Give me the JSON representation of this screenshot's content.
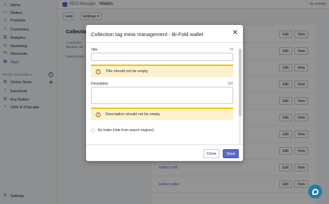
{
  "sidebar": {
    "items": [
      {
        "label": "Home",
        "icon": "home-icon"
      },
      {
        "label": "Orders",
        "icon": "orders-icon"
      },
      {
        "label": "Products",
        "icon": "products-icon"
      },
      {
        "label": "Customers",
        "icon": "customers-icon"
      },
      {
        "label": "Analytics",
        "icon": "analytics-icon"
      },
      {
        "label": "Marketing",
        "icon": "marketing-icon"
      },
      {
        "label": "Discounts",
        "icon": "discounts-icon"
      },
      {
        "label": "Apps",
        "icon": "apps-icon",
        "active": true
      }
    ],
    "channels_heading": "SALES CHANNELS",
    "channels": [
      {
        "label": "Online Store",
        "icon": "store-icon"
      },
      {
        "label": "Facebook",
        "icon": "facebook-icon"
      },
      {
        "label": "Buy Button",
        "icon": "buy-button-icon"
      },
      {
        "label": "Click & Drop app",
        "icon": "click-drop-icon"
      }
    ],
    "settings_label": "Settings"
  },
  "topbar": {
    "app_name": "SEO Manager",
    "separator": "·",
    "page": "Wallets",
    "user": "by venntro"
  },
  "toolbar": {
    "help_label": "Help",
    "settings_label": "Settings ▾"
  },
  "card": {
    "title": "Collection",
    "desc": "Control the Manage coll",
    "link": "Learn more"
  },
  "table": {
    "rows": [
      {
        "name": ""
      },
      {
        "name": ""
      },
      {
        "name": ""
      },
      {
        "name": ""
      },
      {
        "name": ""
      },
      {
        "name": ""
      },
      {
        "name": ""
      },
      {
        "name": ""
      },
      {
        "name": "leather craft"
      },
      {
        "name": "leather wallet"
      }
    ],
    "edit_label": "Edit",
    "view_label": "View"
  },
  "modal": {
    "title": "Collection tag meta management - Bi-Fold wallet",
    "title_field": {
      "label": "Title",
      "counter": "70",
      "value": ""
    },
    "title_warning": "Title should not be empty",
    "description_field": {
      "label": "Description",
      "counter": "160",
      "value": ""
    },
    "description_warning": "Description should not be empty",
    "noindex_label": "No Index (hide from search engines)",
    "close_label": "Close",
    "save_label": "Save"
  },
  "colors": {
    "accent": "#5c6ac4",
    "warning_bg": "#fcf1cd",
    "warning_border": "#eec200",
    "help_fab": "#1f7ea1"
  }
}
